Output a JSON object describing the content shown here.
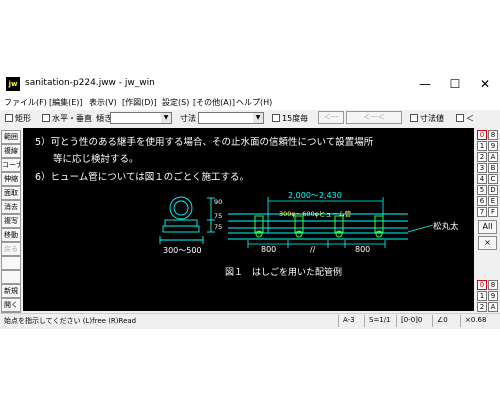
{
  "window": {
    "app_icon": "jw",
    "title": "sanitation-p224.jww - jw_win",
    "controls": {
      "minimize": "—",
      "maximize": "☐",
      "close": "✕"
    }
  },
  "menubar": {
    "items": [
      "ファイル(F)",
      "[編集(E)]",
      "表示(V)",
      "[作図(D)]",
      "設定(S)",
      "[その他(A)]",
      "ヘルプ(H)"
    ]
  },
  "toolbar": {
    "rect_label": "矩形",
    "hv_label": "水平・垂直",
    "incline_label": "傾き",
    "incline_value": "",
    "dim_label": "寸法",
    "dim_value": "",
    "deg15_label": "15度毎",
    "left_arrow_button": "＜---",
    "right_arrow_button": "＜---＜",
    "dimval_label": "寸法値",
    "lt_label": "＜"
  },
  "left_tools": [
    "範囲",
    "複線",
    "コーナー",
    "伸縮",
    "面取",
    "消去",
    "複写",
    "移動",
    "戻る",
    "",
    "",
    "新規",
    "開く",
    "上書"
  ],
  "document": {
    "line1": "5）可とう性のある継手を使用する場合、その止水面の信頼性について設置場所",
    "line2": "等に応じ検討する。",
    "line3": "6）ヒューム管については図１のごとく施工する。"
  },
  "drawing": {
    "dim_top": "2,000～2,430",
    "pipe_label": "300φ～600φヒューム管",
    "dim_bottom_left": "800",
    "dim_gap": "//",
    "dim_bottom_right": "800",
    "dim_width": "300～500",
    "dim_h1": "90",
    "dim_h2": "75",
    "dim_h3": "75",
    "log_label": "松丸太",
    "caption": "図１　はしごを用いた配管例"
  },
  "right_tools": {
    "layers_left": [
      "0",
      "1",
      "2",
      "3",
      "4",
      "5",
      "6",
      "7"
    ],
    "layers_right": [
      "8",
      "9",
      "A",
      "B",
      "C",
      "D",
      "E",
      "F"
    ],
    "all_label": "All",
    "x_label": "×",
    "group_left": [
      "0",
      "1",
      "2"
    ],
    "group_right": [
      "8",
      "9",
      "A"
    ]
  },
  "status": {
    "message": "始点を指示してください (L)free (R)Read",
    "paper": "A-3",
    "scale": "S=1/1",
    "layer": "[0-0]0",
    "angle": "∠0",
    "zoom": "×0.68"
  },
  "colors": {
    "canvas_bg": "#000000",
    "drawing_cyan": "#00ffff",
    "drawing_yellow": "#ffff66",
    "drawing_green": "#33ff33",
    "layer_active": "#dd0000"
  }
}
